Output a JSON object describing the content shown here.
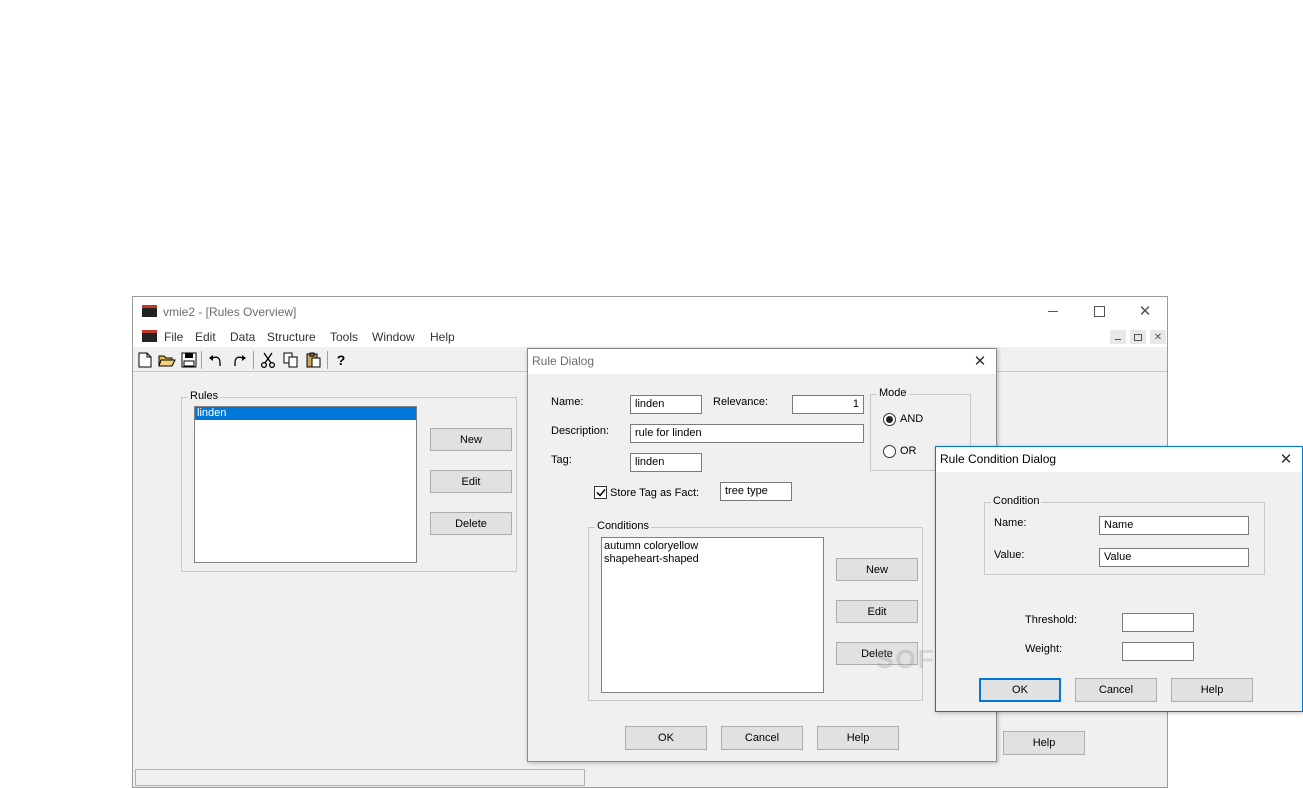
{
  "main_window": {
    "title": "vmie2 - [Rules Overview]",
    "app_icon": "vmie-logo-icon",
    "menu": [
      "File",
      "Edit",
      "Data",
      "Structure",
      "Tools",
      "Window",
      "Help"
    ],
    "toolbar": [
      "new-file-icon",
      "open-folder-icon",
      "save-icon",
      "undo-icon",
      "redo-icon",
      "cut-icon",
      "copy-icon",
      "paste-icon",
      "help-question-icon"
    ],
    "rules_group": "Rules",
    "rules_list": [
      "linden"
    ],
    "buttons": {
      "new": "New",
      "edit": "Edit",
      "delete": "Delete",
      "help": "Help"
    }
  },
  "rule_dialog": {
    "title": "Rule Dialog",
    "name_label": "Name:",
    "name_value": "linden",
    "relevance_label": "Relevance:",
    "relevance_value": "1",
    "description_label": "Description:",
    "description_value": "rule for linden",
    "tag_label": "Tag:",
    "tag_value": "linden",
    "store_tag_label": "Store Tag as Fact:",
    "store_tag_checked": true,
    "store_tag_value": "tree type",
    "mode_group": "Mode",
    "mode_and": "AND",
    "mode_or": "OR",
    "mode_selected": "AND",
    "conditions_group": "Conditions",
    "conditions": [
      "autumn coloryellow",
      "shapeheart-shaped"
    ],
    "buttons": {
      "new": "New",
      "edit": "Edit",
      "delete": "Delete",
      "ok": "OK",
      "cancel": "Cancel",
      "help": "Help"
    }
  },
  "condition_dialog": {
    "title": "Rule Condition Dialog",
    "condition_group": "Condition",
    "name_label": "Name:",
    "name_value": "Name",
    "value_label": "Value:",
    "value_value": "Value",
    "threshold_label": "Threshold:",
    "threshold_value": "",
    "weight_label": "Weight:",
    "weight_value": "",
    "buttons": {
      "ok": "OK",
      "cancel": "Cancel",
      "help": "Help"
    }
  },
  "watermark": "SOFTPEDIA",
  "colors": {
    "selection": "#0078d7",
    "window_bg": "#f0f0f0",
    "accent_border": "#0078d7"
  }
}
